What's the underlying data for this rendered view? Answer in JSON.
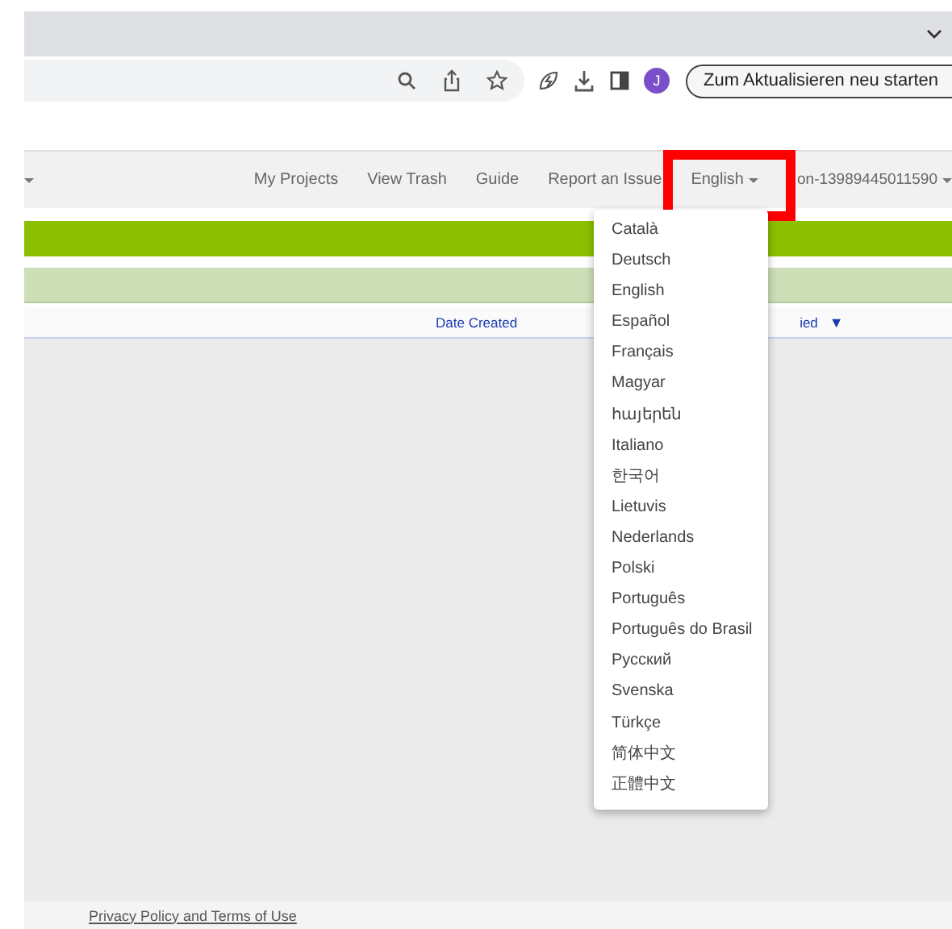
{
  "browser": {
    "update_button": "Zum Aktualisieren neu starten",
    "profile_initial": "J"
  },
  "nav": {
    "items": [
      {
        "label": "My Projects"
      },
      {
        "label": "View Trash"
      },
      {
        "label": "Guide"
      },
      {
        "label": "Report an Issue"
      }
    ],
    "language": "English",
    "account": "on-13989445011590"
  },
  "table": {
    "columns": [
      {
        "label": "Date Created",
        "sorted": false
      },
      {
        "label": "ied",
        "sorted": true,
        "sort_arrow": "▼"
      }
    ]
  },
  "language_menu": {
    "items": [
      {
        "label": "Català"
      },
      {
        "label": "Deutsch"
      },
      {
        "label": "English"
      },
      {
        "label": "Español"
      },
      {
        "label": "Français"
      },
      {
        "label": "Magyar"
      },
      {
        "label": "հայերեն"
      },
      {
        "label": "Italiano"
      },
      {
        "label": "한국어"
      },
      {
        "label": "Lietuvis"
      },
      {
        "label": "Nederlands"
      },
      {
        "label": "Polski"
      },
      {
        "label": "Português"
      },
      {
        "label": "Português do Brasil"
      },
      {
        "label": "Русский"
      },
      {
        "label": "Svenska"
      },
      {
        "label": "Türkçe"
      },
      {
        "label": "简体中文"
      },
      {
        "label": "正體中文"
      }
    ]
  },
  "footer": {
    "link": "Privacy Policy and Terms of Use"
  }
}
